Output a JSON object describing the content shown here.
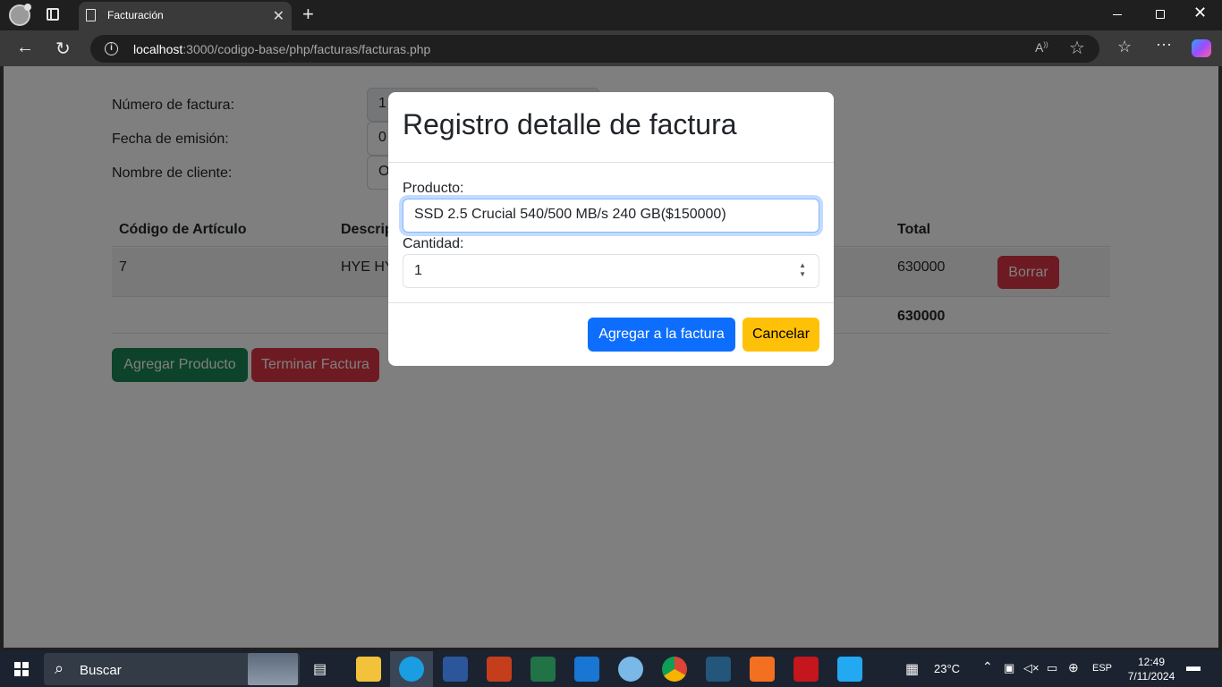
{
  "browser": {
    "tab_title": "Facturación",
    "url_host": "localhost",
    "url_path": ":3000/codigo-base/php/facturas/facturas.php"
  },
  "form": {
    "invoice_number_label": "Número de factura:",
    "invoice_number_value": "1",
    "date_label": "Fecha de emisión:",
    "date_value": "0",
    "client_label": "Nombre de cliente:",
    "client_value": "O"
  },
  "table": {
    "headers": [
      "Código de Artículo",
      "Descrip",
      "Total"
    ],
    "rows": [
      {
        "code": "7",
        "description": "HYE HY",
        "total": "630000",
        "delete_label": "Borrar"
      }
    ],
    "grand_total": "630000"
  },
  "actions": {
    "add_product": "Agregar Producto",
    "finish_invoice": "Terminar Factura"
  },
  "modal": {
    "title": "Registro detalle de factura",
    "product_label": "Producto:",
    "product_value": "SSD 2.5 Crucial 540/500 MB/s 240 GB($150000)",
    "quantity_label": "Cantidad:",
    "quantity_value": "1",
    "add_button": "Agregar a la factura",
    "cancel_button": "Cancelar"
  },
  "taskbar": {
    "search_label": "Buscar",
    "weather": "23°C",
    "language": "ESP",
    "time": "12:49",
    "date": "7/11/2024"
  }
}
